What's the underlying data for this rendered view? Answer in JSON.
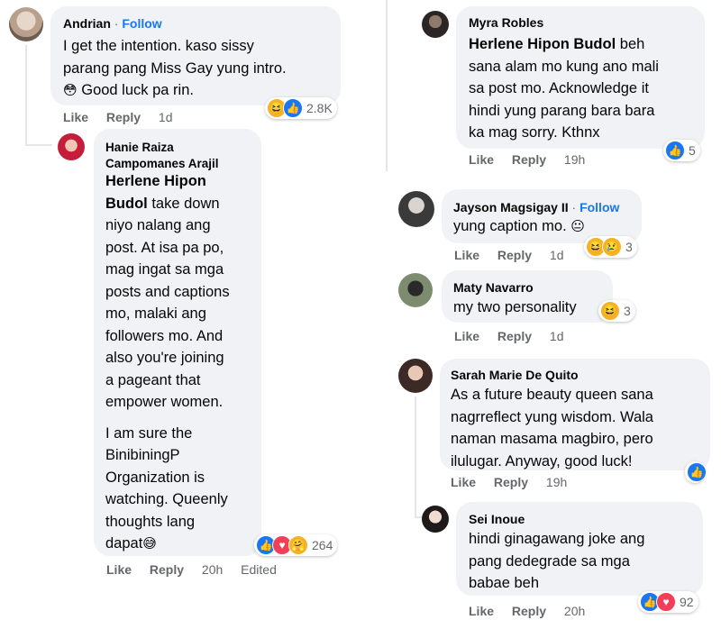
{
  "left": {
    "andrian": {
      "name": "Andrian",
      "follow": "Follow",
      "text_line1": "I get the intention. kaso sissy",
      "text_line2": "parang pang Miss Gay yung intro.",
      "text_line3": "Good luck pa rin.",
      "emoji": "😳",
      "reaction_count": "2.8K",
      "like": "Like",
      "reply": "Reply",
      "time": "1d"
    },
    "hanie": {
      "name_line1": "Hanie Raiza",
      "name_line2": "Campomanes Arajil",
      "tag_line1": "Herlene Hipon",
      "tag_line2": "Budol",
      "lines": [
        "take down",
        "niyo nalang ang",
        "post. At isa pa po,",
        "mag ingat sa mga",
        "posts and captions",
        "mo, malaki ang",
        "followers mo. And",
        "also you're joining",
        "a pageant that",
        "empower women."
      ],
      "para2": [
        "I am sure the",
        "BinibiningP",
        "Organization is",
        "watching. Queenly",
        "thoughts lang",
        "dapat"
      ],
      "emoji": "😅",
      "reaction_count": "264",
      "like": "Like",
      "reply": "Reply",
      "time": "20h",
      "edited": "Edited"
    }
  },
  "right": {
    "myra": {
      "name": "Myra Robles",
      "tag": "Herlene Hipon Budol",
      "lines": [
        "sana alam mo kung ano mali",
        "sa post mo. Acknowledge it",
        "hindi yung parang bara bara",
        "ka mag sorry. Kthnx"
      ],
      "first_tail": "beh",
      "reaction_count": "5",
      "like": "Like",
      "reply": "Reply",
      "time": "19h"
    },
    "jayson": {
      "name": "Jayson Magsigay II",
      "follow": "Follow",
      "text": "yung caption mo.",
      "emoji": "😐",
      "reaction_count": "3",
      "like": "Like",
      "reply": "Reply",
      "time": "1d"
    },
    "maty": {
      "name": "Maty Navarro",
      "text": "my two personality",
      "reaction_count": "3",
      "like": "Like",
      "reply": "Reply",
      "time": "1d"
    },
    "sarah": {
      "name": "Sarah Marie De Quito",
      "lines": [
        "As a future beauty queen sana",
        "nagrreflect yung wisdom. Wala",
        "naman masama magbiro, pero",
        "ilulugar. Anyway, good luck!"
      ],
      "like": "Like",
      "reply": "Reply",
      "time": "19h"
    },
    "sei": {
      "name": "Sei Inoue",
      "lines": [
        "hindi ginagawang joke ang",
        "pang dedegrade sa mga",
        "babae beh"
      ],
      "reaction_count": "92",
      "like": "Like",
      "reply": "Reply",
      "time": "20h"
    }
  },
  "colors": {
    "bubble": "#f0f2f5",
    "accent": "#1877f2",
    "secondary_text": "#65676b"
  }
}
